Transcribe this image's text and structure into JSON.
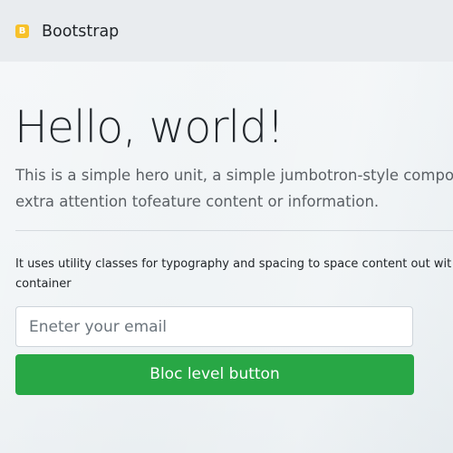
{
  "navbar": {
    "brand_icon": "bootstrap-icon",
    "brand_icon_letter": "B",
    "brand_icon_color": "#f7c12a",
    "brand": "Bootstrap"
  },
  "jumbotron": {
    "title": "Hello, world!",
    "lead_line1": "This is a simple hero unit, a simple jumbotron-style componen",
    "lead_line2": "extra attention tofeature content or information.",
    "text_line1": "It uses utility classes for typography and spacing to space content out wit",
    "text_line2": "container"
  },
  "form": {
    "email_placeholder": "Eneter your email",
    "email_value": "",
    "button_label": "Bloc level button",
    "button_color": "#28a745"
  }
}
